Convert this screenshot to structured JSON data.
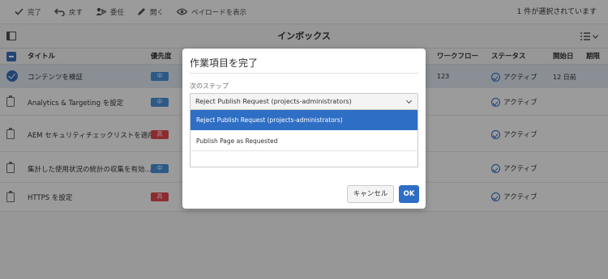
{
  "toolbar": {
    "complete_label": "完了",
    "step_back_label": "戻す",
    "delegate_label": "委任",
    "open_label": "開く",
    "view_payload_label": "ペイロードを表示",
    "selection_status": "1 件が選択されています"
  },
  "header": {
    "title": "インボックス"
  },
  "table": {
    "columns": {
      "title": "タイトル",
      "priority": "優先度",
      "workflow": "ワークフロー",
      "status": "ステータス",
      "start_date": "開始日",
      "due_date": "期限"
    },
    "rows": [
      {
        "title": "コンテンツを検証",
        "priority": "中",
        "workflow": "123",
        "status": "アクティブ",
        "start_date": "12 日前",
        "selected": true
      },
      {
        "title": "Analytics & Targeting を設定",
        "priority": "中",
        "status": "アクティブ"
      },
      {
        "title": "AEM セキュリティチェックリストを適用",
        "priority": "高",
        "status": "アクティブ"
      },
      {
        "title": "集計した使用状況の統計の収集を有効…",
        "priority": "中",
        "status": "アクティブ"
      },
      {
        "title": "HTTPS を設定",
        "priority": "高",
        "status": "アクティブ"
      }
    ]
  },
  "dialog": {
    "title": "作業項目を完了",
    "next_step_label": "次のステップ",
    "selected_value": "Reject Publish Request (projects-administrators)",
    "options": [
      "Reject Publish Request (projects-administrators)",
      "Publish Page as Requested"
    ],
    "cancel_label": "キャンセル",
    "ok_label": "OK"
  },
  "colors": {
    "accent": "#2f6ec5",
    "priority_medium": "#4a90d9",
    "priority_high": "#e34850"
  }
}
